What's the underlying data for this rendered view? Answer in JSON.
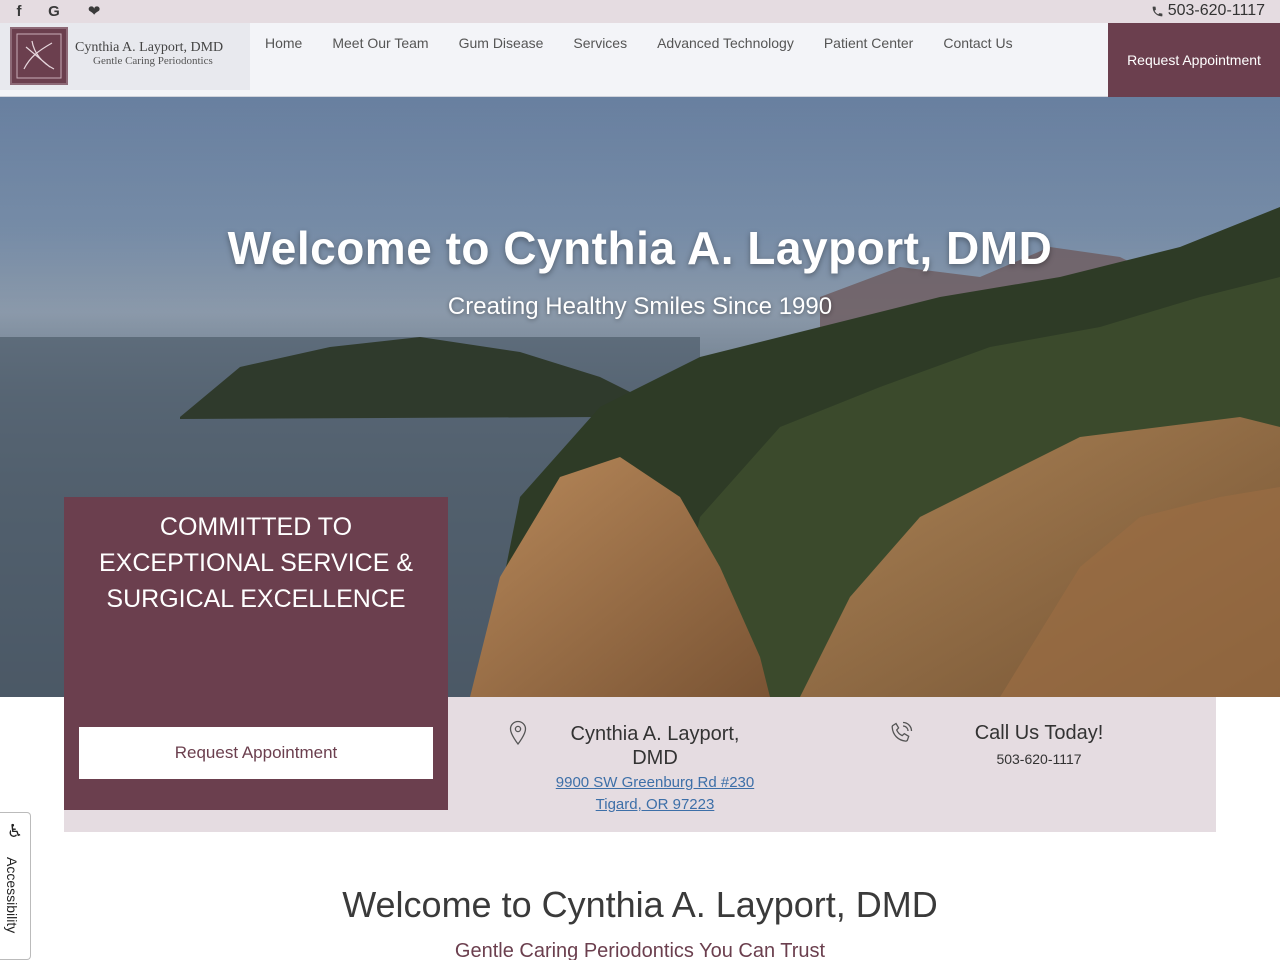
{
  "topbar": {
    "social": [
      {
        "name": "facebook-icon",
        "glyph": "f"
      },
      {
        "name": "google-icon",
        "glyph": "G"
      },
      {
        "name": "healthgrades-icon",
        "glyph": "❤"
      }
    ],
    "phone": "503-620-1117"
  },
  "header": {
    "logo": {
      "name": "Cynthia A. Layport, DMD",
      "tagline": "Gentle Caring Periodontics"
    },
    "nav": [
      "Home",
      "Meet Our Team",
      "Gum Disease",
      "Services",
      "Advanced Technology",
      "Patient Center",
      "Contact Us"
    ],
    "request_button": "Request Appointment"
  },
  "hero": {
    "title": "Welcome to Cynthia A. Layport, DMD",
    "subtitle": "Creating Healthy Smiles Since 1990"
  },
  "commitment": {
    "line1": "COMMITTED TO",
    "line2": "EXCEPTIONAL SERVICE &",
    "line3": "SURGICAL EXCELLENCE",
    "button": "Request Appointment"
  },
  "location": {
    "name": "Cynthia A. Layport, DMD",
    "address_line1": "9900 SW Greenburg Rd #230",
    "address_line2": "Tigard, OR 97223"
  },
  "call": {
    "title": "Call Us Today!",
    "phone": "503-620-1117"
  },
  "welcome": {
    "title": "Welcome to Cynthia A. Layport, DMD",
    "subtitle": "Gentle Caring Periodontics You Can Trust"
  },
  "accessibility": {
    "label": "Accessibility"
  },
  "colors": {
    "brand": "#6b3f4e",
    "strip": "#e5dce1",
    "link": "#3d6fa8"
  }
}
